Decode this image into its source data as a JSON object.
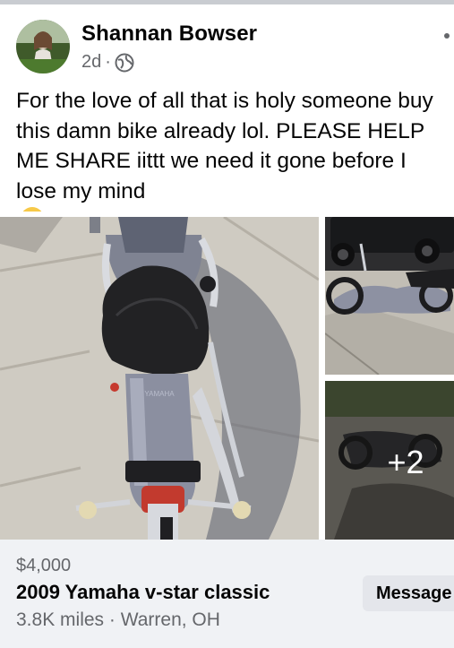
{
  "post": {
    "author": "Shannan Bowser",
    "time": "2d",
    "separator": "·",
    "audience_icon": "globe-icon",
    "menu_icon": "more-options-icon",
    "text_lines": [
      "For the love of all that is holy someone buy",
      "this damn bike already lol. PLEASE HELP",
      "ME SHARE iittt we need it gone before I",
      "lose my mind"
    ],
    "emoji": "tired-face-emoji"
  },
  "photos": {
    "more_count": "+2"
  },
  "listing": {
    "price": "$4,000",
    "title": "2009 Yamaha v-star classic",
    "details": "3.8K miles · Warren, OH",
    "message_label": "Message"
  }
}
